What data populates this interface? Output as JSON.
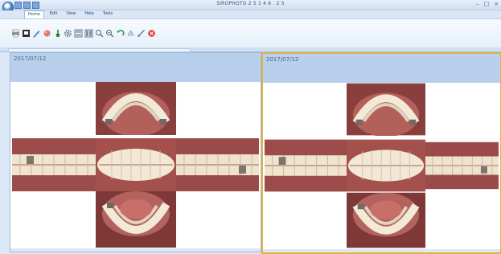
{
  "window": {
    "title": "SIROPHOTO 2 5 1 4 6 . 2 5 "
  },
  "menu": {
    "items": [
      "Home",
      "Edit",
      "View",
      "Help",
      "Tools"
    ]
  },
  "toolbar": {
    "icons": [
      "print-icon",
      "export-icon",
      "pen-icon",
      "color-icon",
      "brush-icon",
      "gear-icon",
      "layout-icon",
      "compare-icon",
      "zoom-in-icon",
      "zoom-out-icon",
      "undo-icon",
      "rotate-icon",
      "ruler-icon",
      "close-red-icon"
    ]
  },
  "panels": {
    "left": {
      "date": "2017/07/12"
    },
    "right": {
      "date": "2017/07/12"
    }
  },
  "photos": [
    "upper-occlusal-photo",
    "right-buccal-photo",
    "frontal-photo",
    "left-buccal-photo",
    "lower-occlusal-photo"
  ],
  "colors": {
    "accent_border": "#e2b23b",
    "header_blue": "#b8d0ec",
    "ribbon_bg": "#e3edf8"
  }
}
